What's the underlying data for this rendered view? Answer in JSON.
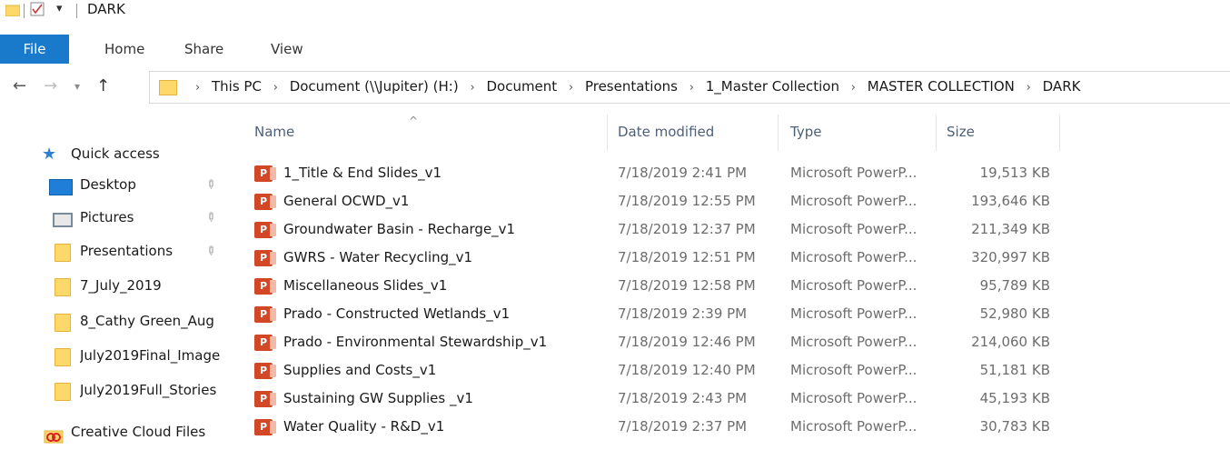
{
  "window": {
    "title": "DARK",
    "quick_access_down_arrow": "▾"
  },
  "ribbon": {
    "tabs": [
      {
        "label": "File"
      },
      {
        "label": "Home"
      },
      {
        "label": "Share"
      },
      {
        "label": "View"
      }
    ]
  },
  "address_bar": {
    "breadcrumbs": [
      "This PC",
      "Document (\\\\Jupiter) (H:)",
      "Document",
      "Presentations",
      "1_Master Collection",
      "MASTER COLLECTION",
      "DARK"
    ],
    "separator": "›"
  },
  "nav_pane": {
    "quick_access": "Quick access",
    "items": [
      {
        "label": "Desktop",
        "icon": "desktop-icon",
        "pinned": true
      },
      {
        "label": "Pictures",
        "icon": "pictures-icon",
        "pinned": true
      },
      {
        "label": "Presentations",
        "icon": "folder-icon",
        "pinned": true
      },
      {
        "label": "7_July_2019",
        "icon": "folder-icon",
        "pinned": false
      },
      {
        "label": "8_Cathy Green_Aug",
        "icon": "folder-icon",
        "pinned": false
      },
      {
        "label": "July2019Final_Image",
        "icon": "folder-icon",
        "pinned": false
      },
      {
        "label": "July2019Full_Stories",
        "icon": "folder-icon",
        "pinned": false
      }
    ],
    "creative_cloud": "Creative Cloud Files"
  },
  "columns": {
    "name": "Name",
    "date": "Date modified",
    "type": "Type",
    "size": "Size"
  },
  "files": [
    {
      "name": "1_Title & End Slides_v1",
      "date": "7/18/2019 2:41 PM",
      "type": "Microsoft PowerP...",
      "size": "19,513 KB"
    },
    {
      "name": "General OCWD_v1",
      "date": "7/18/2019 12:55 PM",
      "type": "Microsoft PowerP...",
      "size": "193,646 KB"
    },
    {
      "name": "Groundwater Basin - Recharge_v1",
      "date": "7/18/2019 12:37 PM",
      "type": "Microsoft PowerP...",
      "size": "211,349 KB"
    },
    {
      "name": "GWRS - Water Recycling_v1",
      "date": "7/18/2019 12:51 PM",
      "type": "Microsoft PowerP...",
      "size": "320,997 KB"
    },
    {
      "name": "Miscellaneous Slides_v1",
      "date": "7/18/2019 12:58 PM",
      "type": "Microsoft PowerP...",
      "size": "95,789 KB"
    },
    {
      "name": "Prado - Constructed Wetlands_v1",
      "date": "7/18/2019 2:39 PM",
      "type": "Microsoft PowerP...",
      "size": "52,980 KB"
    },
    {
      "name": "Prado - Environmental Stewardship_v1",
      "date": "7/18/2019 12:46 PM",
      "type": "Microsoft PowerP...",
      "size": "214,060 KB"
    },
    {
      "name": "Supplies and Costs_v1",
      "date": "7/18/2019 12:40 PM",
      "type": "Microsoft PowerP...",
      "size": "51,181 KB"
    },
    {
      "name": "Sustaining GW Supplies _v1",
      "date": "7/18/2019 2:43 PM",
      "type": "Microsoft PowerP...",
      "size": "45,193 KB"
    },
    {
      "name": "Water Quality - R&D_v1",
      "date": "7/18/2019 2:37 PM",
      "type": "Microsoft PowerP...",
      "size": "30,783 KB"
    }
  ],
  "colors": {
    "file_tab": "#1979ca",
    "header_text": "#4c607a",
    "ppt_icon": "#d24726"
  }
}
